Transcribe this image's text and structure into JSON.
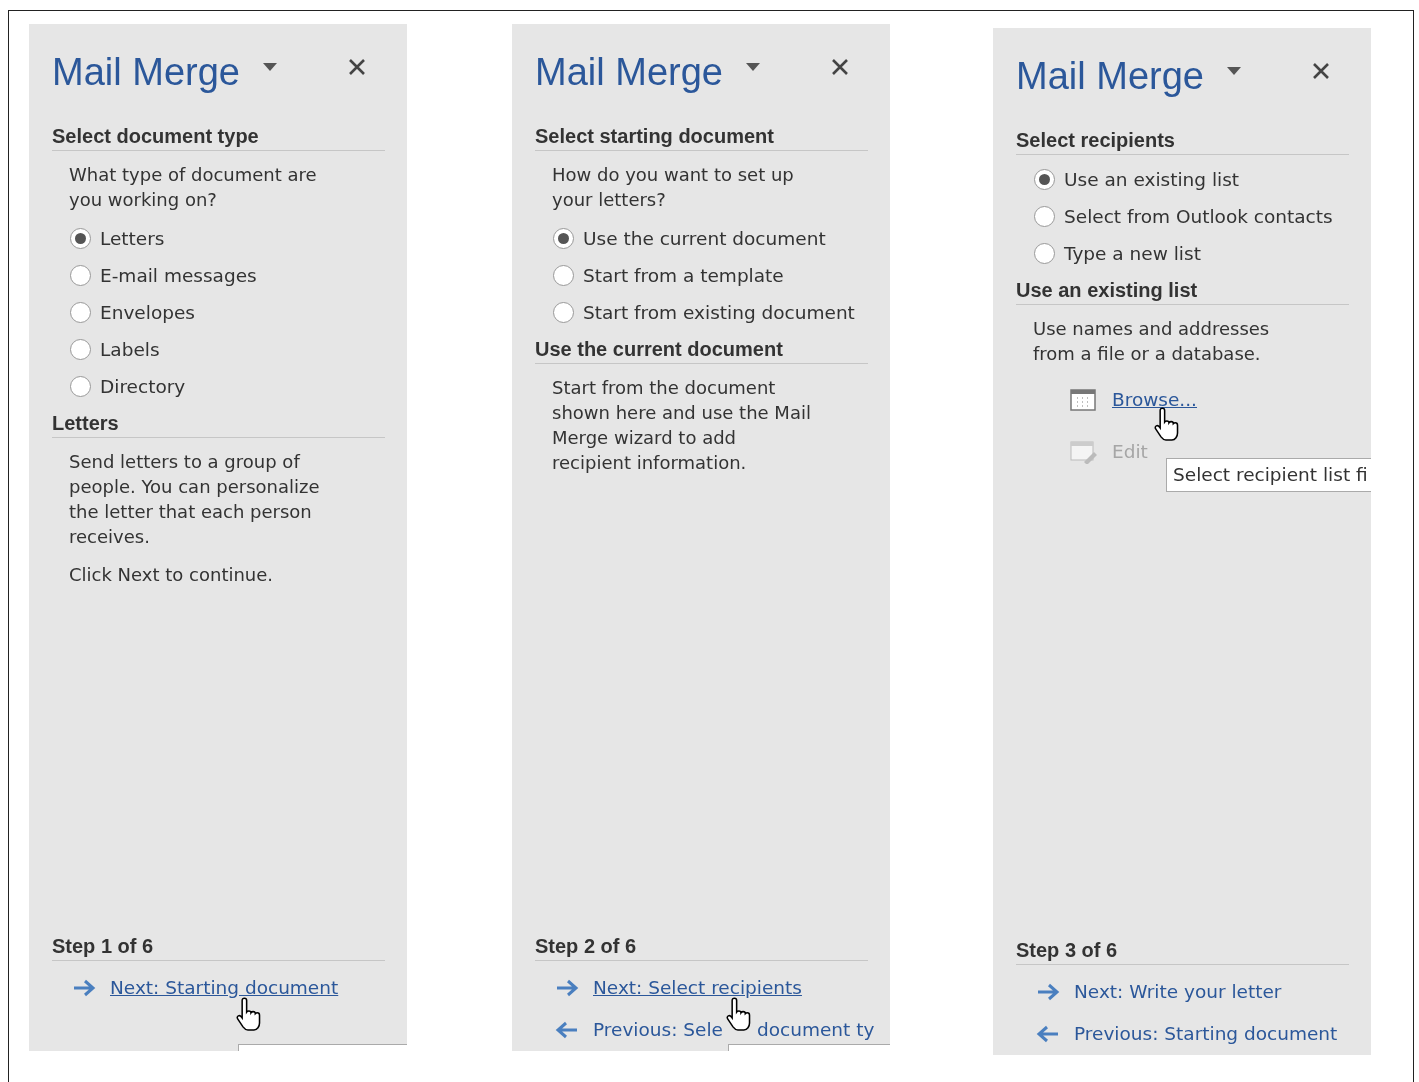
{
  "panels": [
    {
      "title": "Mail Merge",
      "sections": [
        {
          "heading": "Select document type",
          "items": [
            {
              "kind": "text",
              "text": "What type of document are\nyou working on?"
            },
            {
              "kind": "radio",
              "label": "Letters",
              "selected": true
            },
            {
              "kind": "radio",
              "label": "E-mail messages",
              "selected": false
            },
            {
              "kind": "radio",
              "label": "Envelopes",
              "selected": false
            },
            {
              "kind": "radio",
              "label": "Labels",
              "selected": false
            },
            {
              "kind": "radio",
              "label": "Directory",
              "selected": false
            }
          ]
        },
        {
          "heading": "Letters",
          "items": [
            {
              "kind": "text",
              "text": "Send letters to a group of\npeople. You can personalize\nthe letter that each person\nreceives."
            },
            {
              "kind": "text",
              "text": "Click Next to continue."
            }
          ]
        }
      ],
      "step": {
        "heading": "Step 1 of 6",
        "links": [
          {
            "kind": "next",
            "parts": [
              "Next: Starting document"
            ],
            "hovered": true
          }
        ]
      }
    },
    {
      "title": "Mail Merge",
      "sections": [
        {
          "heading": "Select starting document",
          "items": [
            {
              "kind": "text",
              "text": "How do you want to set up\nyour letters?"
            },
            {
              "kind": "radio",
              "label": "Use the current document",
              "selected": true
            },
            {
              "kind": "radio",
              "label": "Start from a template",
              "selected": false
            },
            {
              "kind": "radio",
              "label": "Start from existing document",
              "selected": false
            }
          ]
        },
        {
          "heading": "Use the current document",
          "items": [
            {
              "kind": "text",
              "text": "Start from the document\nshown here and use the Mail\nMerge wizard to add\nrecipient information."
            }
          ]
        }
      ],
      "step": {
        "heading": "Step 2 of 6",
        "links": [
          {
            "kind": "next",
            "parts": [
              "Next: Select recipients"
            ],
            "hovered": true
          },
          {
            "kind": "previous",
            "parts": [
              "Previous: Sele",
              "document ty"
            ],
            "hovered": false
          }
        ]
      }
    },
    {
      "title": "Mail Merge",
      "sections": [
        {
          "heading": "Select recipients",
          "items": [
            {
              "kind": "radio",
              "label": "Use an existing list",
              "selected": true
            },
            {
              "kind": "radio",
              "label": "Select from Outlook contacts",
              "selected": false
            },
            {
              "kind": "radio",
              "label": "Type a new list",
              "selected": false
            }
          ]
        },
        {
          "heading": "Use an existing list",
          "items": [
            {
              "kind": "text",
              "text": "Use names and addresses\nfrom a file or a database."
            },
            {
              "kind": "action",
              "label": "Browse...",
              "disabled": false,
              "hovered": true,
              "tooltip": "Select recipient list fi"
            },
            {
              "kind": "action",
              "label": "Edit",
              "disabled": true,
              "hovered": false
            }
          ]
        }
      ],
      "step": {
        "heading": "Step 3 of 6",
        "links": [
          {
            "kind": "next",
            "parts": [
              "Next: Write your letter"
            ],
            "hovered": false
          },
          {
            "kind": "previous",
            "parts": [
              "Previous: Starting document"
            ],
            "hovered": false
          }
        ]
      }
    }
  ]
}
